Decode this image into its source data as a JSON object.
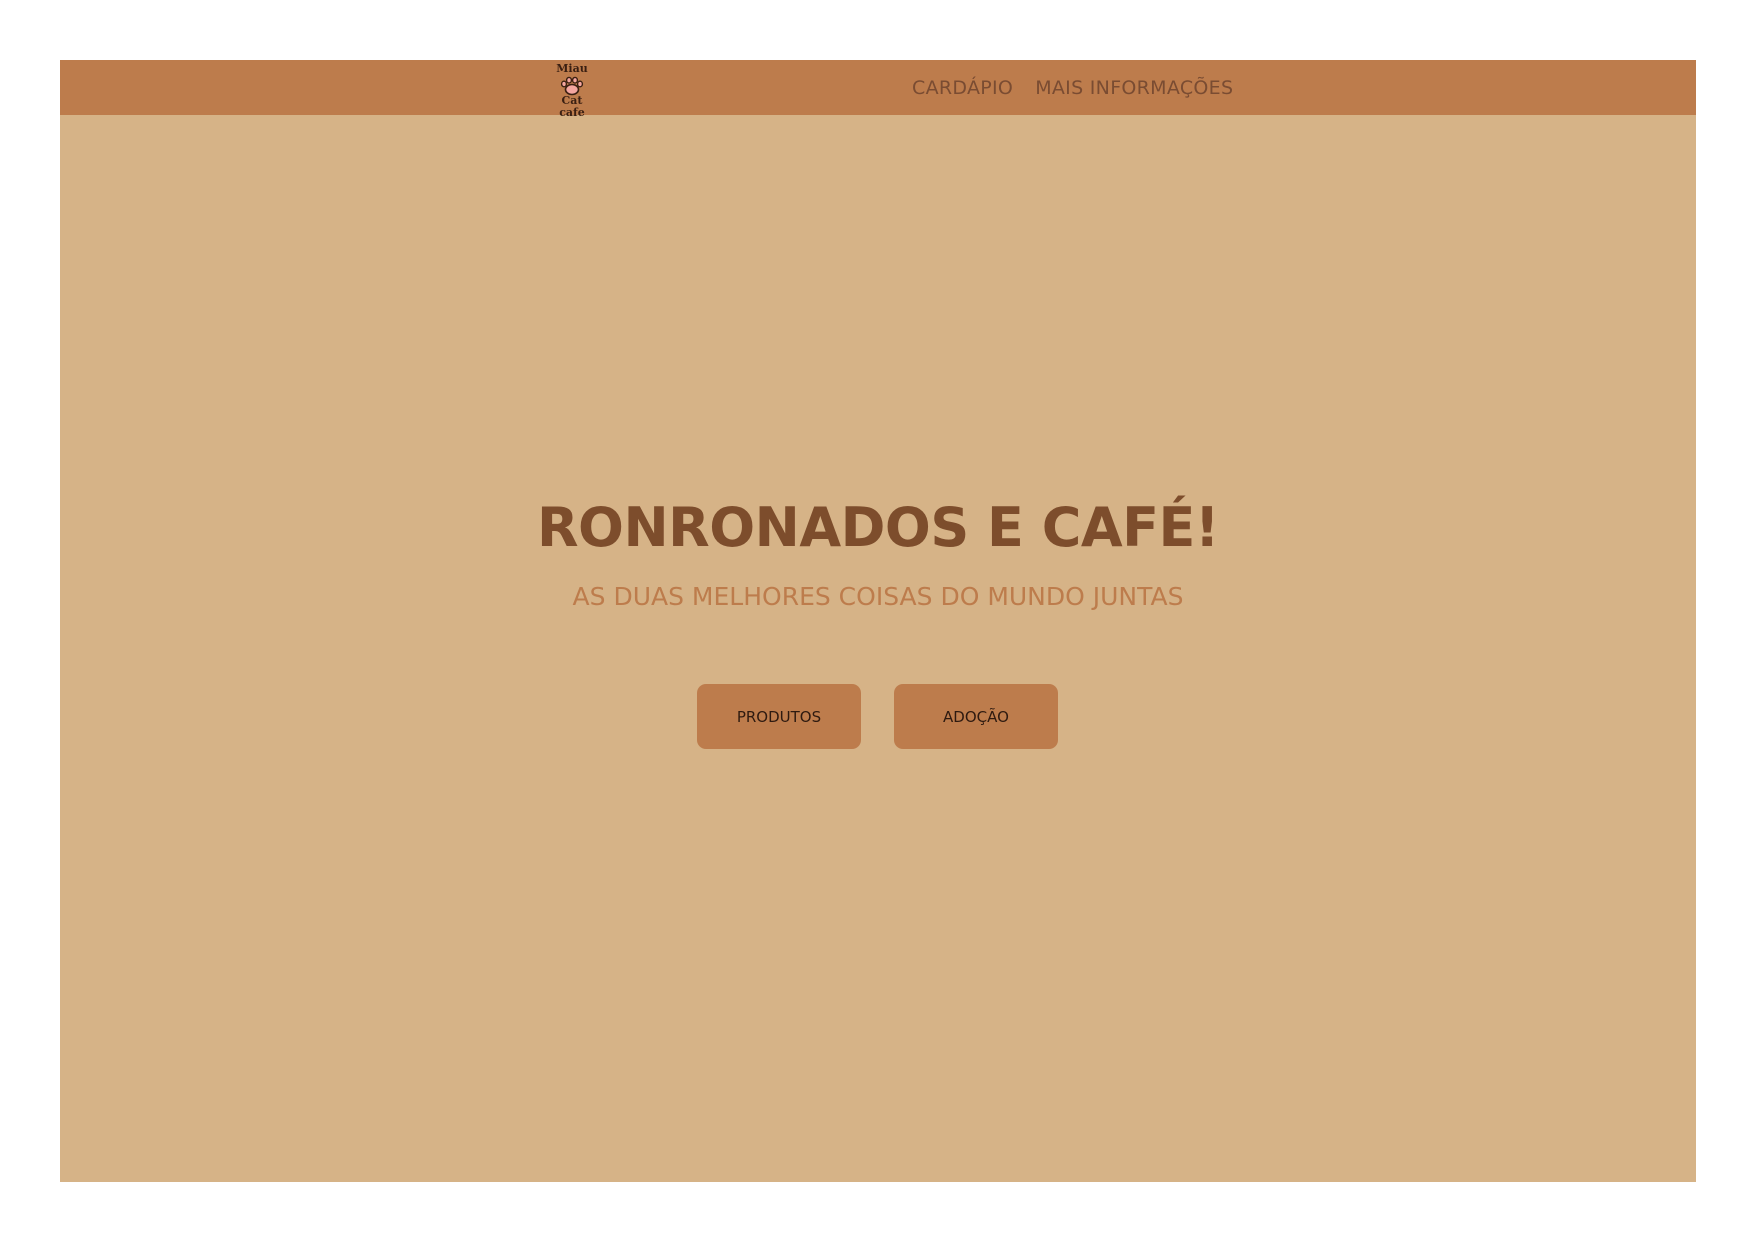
{
  "brand": {
    "logo_top": "Miau",
    "logo_bottom": "Cat cafe"
  },
  "nav": {
    "items": [
      {
        "label": "CARDÁPIO"
      },
      {
        "label": "MAIS INFORMAÇÕES"
      }
    ]
  },
  "hero": {
    "title": "RONRONADOS E CAFÉ!",
    "subtitle": "AS DUAS MELHORES COISAS DO MUNDO JUNTAS",
    "buttons": [
      {
        "label": "PRODUTOS"
      },
      {
        "label": "ADOÇÃO"
      }
    ]
  },
  "colors": {
    "background": "#d6b387",
    "navbar": "#bd7c4c",
    "title": "#7d4d2c",
    "subtitle": "#bd7c4c",
    "button": "#bd7c4c",
    "paw": "#f4a6a0"
  },
  "icons": {
    "logo": "paw-icon"
  }
}
